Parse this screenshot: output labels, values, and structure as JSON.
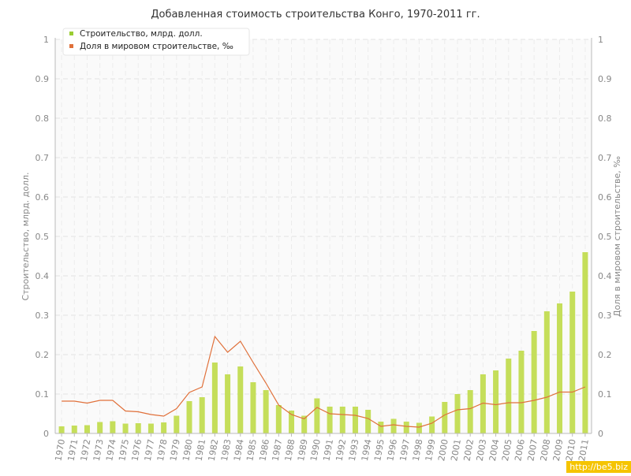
{
  "chart_data": {
    "type": "bar",
    "title": "Добавленная стоимость строительства Конго, 1970-2011 гг.",
    "ylabel": "Строительство, млрд. долл.",
    "y2label": "Доля в мировом строительстве, ‰",
    "ylim": [
      0,
      1
    ],
    "y2lim": [
      0,
      1
    ],
    "yticks": [
      "0",
      "0.1",
      "0.2",
      "0.3",
      "0.4",
      "0.5",
      "0.6",
      "0.7",
      "0.8",
      "0.9",
      "1"
    ],
    "grid": true,
    "legend_position": "top-left",
    "categories": [
      "1970",
      "1971",
      "1972",
      "1973",
      "1974",
      "1975",
      "1976",
      "1977",
      "1978",
      "1979",
      "1980",
      "1981",
      "1982",
      "1983",
      "1984",
      "1985",
      "1986",
      "1987",
      "1988",
      "1989",
      "1990",
      "1991",
      "1992",
      "1993",
      "1994",
      "1995",
      "1996",
      "1997",
      "1998",
      "1999",
      "2000",
      "2001",
      "2002",
      "2003",
      "2004",
      "2005",
      "2006",
      "2007",
      "2008",
      "2009",
      "2010",
      "2011"
    ],
    "series": [
      {
        "name": "Строительство, млрд. долл.",
        "type": "bar",
        "axis": "left",
        "color": "#c5de5a",
        "values": [
          0.018,
          0.02,
          0.021,
          0.029,
          0.031,
          0.025,
          0.026,
          0.025,
          0.028,
          0.045,
          0.082,
          0.092,
          0.18,
          0.15,
          0.17,
          0.13,
          0.11,
          0.072,
          0.058,
          0.045,
          0.089,
          0.068,
          0.068,
          0.068,
          0.06,
          0.03,
          0.037,
          0.03,
          0.027,
          0.043,
          0.08,
          0.1,
          0.11,
          0.15,
          0.16,
          0.19,
          0.21,
          0.26,
          0.31,
          0.33,
          0.36,
          0.46
        ]
      },
      {
        "name": "Доля в мировом строительстве, ‰",
        "type": "line",
        "axis": "right",
        "color": "#e0703a",
        "values": [
          0.082,
          0.082,
          0.077,
          0.084,
          0.084,
          0.057,
          0.055,
          0.048,
          0.044,
          0.063,
          0.104,
          0.118,
          0.246,
          0.206,
          0.234,
          0.18,
          0.128,
          0.072,
          0.048,
          0.037,
          0.066,
          0.05,
          0.048,
          0.046,
          0.038,
          0.018,
          0.022,
          0.018,
          0.016,
          0.026,
          0.047,
          0.06,
          0.063,
          0.077,
          0.073,
          0.078,
          0.078,
          0.084,
          0.092,
          0.105,
          0.105,
          0.118
        ]
      }
    ]
  },
  "watermark": "http://be5.biz"
}
